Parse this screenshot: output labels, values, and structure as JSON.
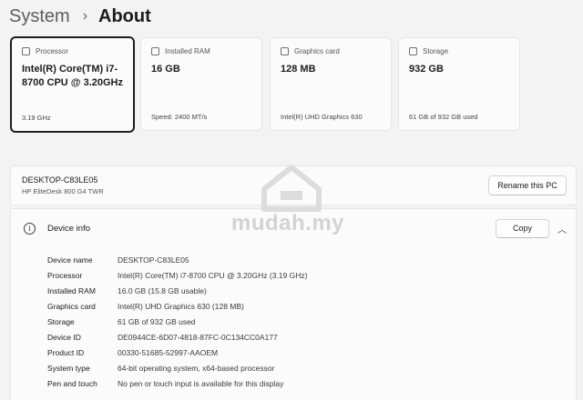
{
  "breadcrumb": {
    "root": "System",
    "separator": "›",
    "current": "About"
  },
  "cards": [
    {
      "title": "Processor",
      "value": "Intel(R) Core(TM) i7-8700 CPU @ 3.20GHz",
      "sub": "3.19 GHz",
      "icon": "processor-icon"
    },
    {
      "title": "Installed RAM",
      "value": "16 GB",
      "sub": "Speed: 2400 MT/s",
      "icon": "ram-icon"
    },
    {
      "title": "Graphics card",
      "value": "128 MB",
      "sub": "Intel(R) UHD Graphics 630",
      "icon": "graphics-card-icon"
    },
    {
      "title": "Storage",
      "value": "932 GB",
      "sub": "61 GB of 932 GB used",
      "icon": "storage-icon"
    }
  ],
  "pc": {
    "name": "DESKTOP-C83LE05",
    "model": "HP EliteDesk 800 G4 TWR",
    "rename_label": "Rename this PC"
  },
  "device_info": {
    "title": "Device info",
    "copy_label": "Copy",
    "specs": [
      {
        "label": "Device name",
        "value": "DESKTOP-C83LE05"
      },
      {
        "label": "Processor",
        "value": "Intel(R) Core(TM) i7-8700 CPU @ 3.20GHz (3.19 GHz)"
      },
      {
        "label": "Installed RAM",
        "value": "16.0 GB (15.8 GB usable)"
      },
      {
        "label": "Graphics card",
        "value": "Intel(R) UHD Graphics 630 (128 MB)"
      },
      {
        "label": "Storage",
        "value": "61 GB of 932 GB used"
      },
      {
        "label": "Device ID",
        "value": "DE0944CE-6D07-4818-87FC-0C134CC0A177"
      },
      {
        "label": "Product ID",
        "value": "00330-51685-52997-AAOEM"
      },
      {
        "label": "System type",
        "value": "64-bit operating system, x64-based processor"
      },
      {
        "label": "Pen and touch",
        "value": "No pen or touch input is available for this display"
      }
    ]
  },
  "watermark": {
    "text": "mudah.my"
  }
}
